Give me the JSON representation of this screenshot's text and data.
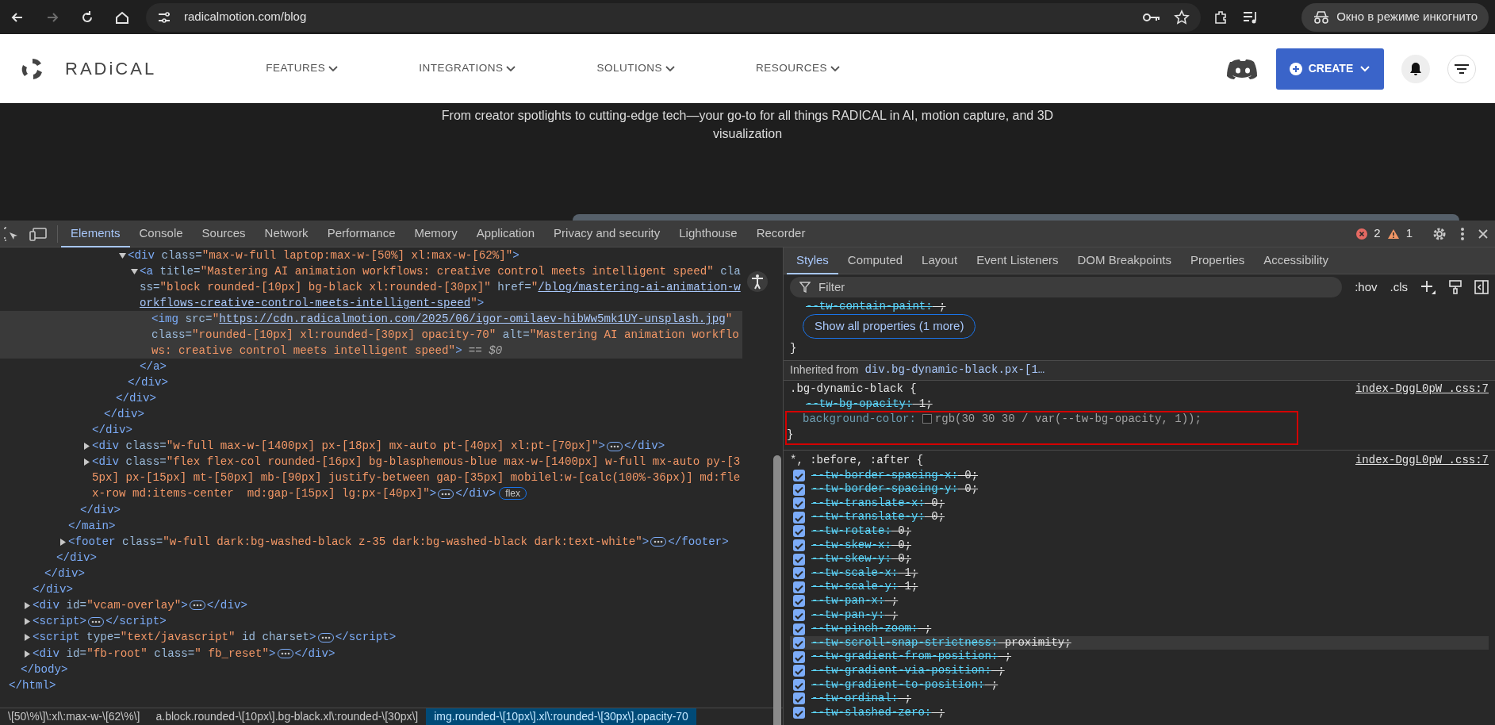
{
  "browser": {
    "nav_buttons": [
      {
        "kind": "back",
        "disabled": false
      },
      {
        "kind": "forward",
        "disabled": true
      },
      {
        "kind": "reload",
        "disabled": false
      },
      {
        "kind": "home",
        "disabled": false
      }
    ],
    "address": "radicalmotion.com/blog",
    "incognito_label": "Окно в режиме инкогнито"
  },
  "site": {
    "logo": "RADiCAL",
    "nav": [
      {
        "label": "FEATURES"
      },
      {
        "label": "INTEGRATIONS"
      },
      {
        "label": "SOLUTIONS"
      },
      {
        "label": "RESOURCES"
      }
    ],
    "create_button": "CREATE",
    "hero_text": "From creator spotlights to cutting-edge tech—your go-to for all things RADICAL in AI, motion capture, and 3D visualization"
  },
  "devtools": {
    "tabs": [
      {
        "label": "Elements",
        "selected": true
      },
      {
        "label": "Console",
        "selected": false
      },
      {
        "label": "Sources",
        "selected": false
      },
      {
        "label": "Network",
        "selected": false
      },
      {
        "label": "Performance",
        "selected": false
      },
      {
        "label": "Memory",
        "selected": false
      },
      {
        "label": "Application",
        "selected": false
      },
      {
        "label": "Privacy and security",
        "selected": false
      },
      {
        "label": "Lighthouse",
        "selected": false
      },
      {
        "label": "Recorder",
        "selected": false
      }
    ],
    "errors": "2",
    "warnings": "1",
    "dom": [
      {
        "selected": false,
        "close": [
          {
            "kind": "tag",
            "text": "</html>"
          }
        ],
        "children": [
          {
            "selected": false,
            "close": [
              {
                "kind": "tag",
                "text": "</body>"
              }
            ],
            "children": [
              {
                "selected": false,
                "close": [
                  {
                    "kind": "tag",
                    "text": "</div>"
                  }
                ],
                "children": [
                  {
                    "selected": false,
                    "close": [
                      {
                        "kind": "tag",
                        "text": "</div>"
                      }
                    ],
                    "children": [
                      {
                        "selected": false,
                        "close": [
                          {
                            "kind": "tag",
                            "text": "</div>"
                          }
                        ],
                        "children": [
                          {
                            "selected": false,
                            "close": [
                              {
                                "kind": "tag",
                                "text": "</main>"
                              }
                            ],
                            "children": [
                              {
                                "selected": false,
                                "close": [
                                  {
                                    "kind": "tag",
                                    "text": "</div>"
                                  }
                                ],
                                "children": [
                                  {
                                    "selected": false,
                                    "close": [
                                      {
                                        "kind": "tag",
                                        "text": "</div>"
                                      }
                                    ],
                                    "children": [
                                      {
                                        "selected": false,
                                        "close": [
                                          {
                                            "kind": "tag",
                                            "text": "</div>"
                                          }
                                        ],
                                        "children": [
                                          {
                                            "selected": false,
                                            "close": [
                                              {
                                                "kind": "tag",
                                                "text": "</div>"
                                              }
                                            ],
                                            "children": [
                                              {
                                                "selected": false,
                                                "expanded": true,
                                                "open": [
                                                  {
                                                    "kind": "tag",
                                                    "text": "<div"
                                                  },
                                                  {
                                                    "kind": "attr",
                                                    "text": " class="
                                                  },
                                                  {
                                                    "kind": "val",
                                                    "text": "\"max-w-full laptop:max-w-[50%] xl:max-w-[62%]\""
                                                  },
                                                  {
                                                    "kind": "tag",
                                                    "text": ">"
                                                  }
                                                ],
                                                "close": [
                                                  {
                                                    "kind": "tag",
                                                    "text": "</div>"
                                                  }
                                                ],
                                                "children": [
                                                  {
                                                    "selected": false,
                                                    "expanded": true,
                                                    "open": [
                                                      {
                                                        "kind": "tag",
                                                        "text": "<a"
                                                      },
                                                      {
                                                        "kind": "attr",
                                                        "text": " title="
                                                      },
                                                      {
                                                        "kind": "val",
                                                        "text": "\"Mastering AI animation workflows: creative control meets intelligent speed\""
                                                      },
                                                      {
                                                        "kind": "attr",
                                                        "text": " class="
                                                      },
                                                      {
                                                        "kind": "val",
                                                        "text": "\"block rounded-[10px] bg-black xl:rounded-[30px]\""
                                                      },
                                                      {
                                                        "kind": "attr",
                                                        "text": " href="
                                                      },
                                                      {
                                                        "kind": "val",
                                                        "text": "\""
                                                      },
                                                      {
                                                        "kind": "link",
                                                        "text": "/blog/mastering-ai-animation-workflows-creative-control-meets-intelligent-speed"
                                                      },
                                                      {
                                                        "kind": "val",
                                                        "text": "\""
                                                      },
                                                      {
                                                        "kind": "tag",
                                                        "text": ">"
                                                      }
                                                    ],
                                                    "close": [
                                                      {
                                                        "kind": "tag",
                                                        "text": "</a>"
                                                      }
                                                    ],
                                                    "children": [
                                                      {
                                                        "selected": true,
                                                        "marker": "== $0",
                                                        "open": [
                                                          {
                                                            "kind": "tag",
                                                            "text": "<img"
                                                          },
                                                          {
                                                            "kind": "attr",
                                                            "text": " src="
                                                          },
                                                          {
                                                            "kind": "val",
                                                            "text": "\""
                                                          },
                                                          {
                                                            "kind": "link",
                                                            "text": "https://cdn.radicalmotion.com/2025/06/igor-omilaev-hibWw5mk1UY-unsplash.jpg"
                                                          },
                                                          {
                                                            "kind": "val",
                                                            "text": "\""
                                                          },
                                                          {
                                                            "kind": "attr",
                                                            "text": " class="
                                                          },
                                                          {
                                                            "kind": "val",
                                                            "text": "\"rounded-[10px] xl:rounded-[30px] opacity-70\""
                                                          },
                                                          {
                                                            "kind": "attr",
                                                            "text": " alt="
                                                          },
                                                          {
                                                            "kind": "val",
                                                            "text": "\"Mastering AI animation workflows: creative control meets intelligent speed\""
                                                          },
                                                          {
                                                            "kind": "tag",
                                                            "text": ">"
                                                          }
                                                        ]
                                                      }
                                                    ]
                                                  }
                                                ]
                                              }
                                            ]
                                          }
                                        ]
                                      }
                                    ]
                                  },
                                  {
                                    "selected": false,
                                    "expanded": false,
                                    "open": [
                                      {
                                        "kind": "tag",
                                        "text": "<div"
                                      },
                                      {
                                        "kind": "attr",
                                        "text": " class="
                                      },
                                      {
                                        "kind": "val",
                                        "text": "\"w-full max-w-[1400px] px-[18px] mx-auto pt-[40px] xl:pt-[70px]\""
                                      },
                                      {
                                        "kind": "tag",
                                        "text": ">"
                                      }
                                    ],
                                    "close": [
                                      {
                                        "kind": "tag",
                                        "text": "</div>"
                                      }
                                    ]
                                  },
                                  {
                                    "selected": false,
                                    "expanded": false,
                                    "badge": "flex",
                                    "open": [
                                      {
                                        "kind": "tag",
                                        "text": "<div"
                                      },
                                      {
                                        "kind": "attr",
                                        "text": " class="
                                      },
                                      {
                                        "kind": "val",
                                        "text": "\"flex flex-col rounded-[16px] bg-blasphemous-blue max-w-[1400px] w-full mx-auto py-[35px] px-[15px] mt-[50px] mb-[90px] justify-between gap-[35px] mobilel:w-[calc(100%-36px)] md:flex-row md:items-center  md:gap-[15px] lg:px-[40px]\""
                                      },
                                      {
                                        "kind": "tag",
                                        "text": ">"
                                      }
                                    ],
                                    "close": [
                                      {
                                        "kind": "tag",
                                        "text": "</div>"
                                      }
                                    ]
                                  }
                                ]
                              }
                            ]
                          },
                          {
                            "selected": false,
                            "expanded": false,
                            "open": [
                              {
                                "kind": "tag",
                                "text": "<footer"
                              },
                              {
                                "kind": "attr",
                                "text": " class="
                              },
                              {
                                "kind": "val",
                                "text": "\"w-full dark:bg-washed-black z-35 dark:bg-washed-black dark:text-white\""
                              },
                              {
                                "kind": "tag",
                                "text": ">"
                              }
                            ],
                            "close": [
                              {
                                "kind": "tag",
                                "text": "</footer>"
                              }
                            ]
                          }
                        ]
                      }
                    ]
                  }
                ]
              },
              {
                "selected": false,
                "expanded": false,
                "open": [
                  {
                    "kind": "tag",
                    "text": "<div"
                  },
                  {
                    "kind": "attr",
                    "text": " id="
                  },
                  {
                    "kind": "val",
                    "text": "\"vcam-overlay\""
                  },
                  {
                    "kind": "tag",
                    "text": ">"
                  }
                ],
                "close": [
                  {
                    "kind": "tag",
                    "text": "</div>"
                  }
                ]
              },
              {
                "selected": false,
                "expanded": false,
                "open": [
                  {
                    "kind": "tag",
                    "text": "<script>"
                  }
                ],
                "close": [
                  {
                    "kind": "tag",
                    "text": "</script>"
                  }
                ]
              },
              {
                "selected": false,
                "expanded": false,
                "open": [
                  {
                    "kind": "tag",
                    "text": "<script"
                  },
                  {
                    "kind": "attr",
                    "text": " type="
                  },
                  {
                    "kind": "val",
                    "text": "\"text/javascript\""
                  },
                  {
                    "kind": "attr",
                    "text": " id charset"
                  },
                  {
                    "kind": "tag",
                    "text": ">"
                  }
                ],
                "close": [
                  {
                    "kind": "tag",
                    "text": "</script>"
                  }
                ]
              },
              {
                "selected": false,
                "expanded": false,
                "open": [
                  {
                    "kind": "tag",
                    "text": "<div"
                  },
                  {
                    "kind": "attr",
                    "text": " id="
                  },
                  {
                    "kind": "val",
                    "text": "\"fb-root\""
                  },
                  {
                    "kind": "attr",
                    "text": " class="
                  },
                  {
                    "kind": "val",
                    "text": "\" fb_reset\""
                  },
                  {
                    "kind": "tag",
                    "text": ">"
                  }
                ],
                "close": [
                  {
                    "kind": "tag",
                    "text": "</div>"
                  }
                ]
              }
            ]
          }
        ]
      }
    ],
    "breadcrumbs": [
      {
        "label": "\\[50\\%\\]\\:xl\\:max-w-\\[62\\%\\]",
        "selected": false
      },
      {
        "label": "a.block.rounded-\\[10px\\].bg-black.xl\\:rounded-\\[30px\\]",
        "selected": false
      },
      {
        "label": "img.rounded-\\[10px\\].xl\\:rounded-\\[30px\\].opacity-70",
        "selected": true
      }
    ],
    "styles": {
      "tabs": [
        {
          "label": "Styles",
          "selected": true
        },
        {
          "label": "Computed",
          "selected": false
        },
        {
          "label": "Layout",
          "selected": false
        },
        {
          "label": "Event Listeners",
          "selected": false
        },
        {
          "label": "DOM Breakpoints",
          "selected": false
        },
        {
          "label": "Properties",
          "selected": false
        },
        {
          "label": "Accessibility",
          "selected": false
        }
      ],
      "filter_placeholder": "Filter",
      "hov": ":hov",
      "cls": ".cls",
      "tail_prop": {
        "name": "--tw-contain-paint:",
        "value": " ;",
        "overridden": true
      },
      "show_all": "Show all properties (1 more)",
      "tail_close": "}",
      "inherited_label": "Inherited from",
      "inherited_link": "div.bg-dynamic-black.px-[1…",
      "rules": [
        {
          "selector": ".bg-dynamic-black {",
          "source": "index-DggL0pW_.css:7",
          "close": "}",
          "props": [
            {
              "name": "--tw-bg-opacity:",
              "value": " 1;",
              "overridden": true,
              "annotated": false
            },
            {
              "name": "background-color:",
              "color": "#1e1e1e",
              "value": "rgb(30 30 30 / var(--tw-bg-opacity, 1));",
              "overridden": false,
              "annotated": true
            }
          ]
        },
        {
          "selector": "*, :before, :after {",
          "source": "index-DggL0pW_.css:7",
          "props": [
            {
              "name": "--tw-border-spacing-x:",
              "value": " 0;",
              "checked": true,
              "overridden": true,
              "hovered": false
            },
            {
              "name": "--tw-border-spacing-y:",
              "value": " 0;",
              "checked": true,
              "overridden": true,
              "hovered": false
            },
            {
              "name": "--tw-translate-x:",
              "value": " 0;",
              "checked": true,
              "overridden": true,
              "hovered": false
            },
            {
              "name": "--tw-translate-y:",
              "value": " 0;",
              "checked": true,
              "overridden": true,
              "hovered": false
            },
            {
              "name": "--tw-rotate:",
              "value": " 0;",
              "checked": true,
              "overridden": true,
              "hovered": false
            },
            {
              "name": "--tw-skew-x:",
              "value": " 0;",
              "checked": true,
              "overridden": true,
              "hovered": false
            },
            {
              "name": "--tw-skew-y:",
              "value": " 0;",
              "checked": true,
              "overridden": true,
              "hovered": false
            },
            {
              "name": "--tw-scale-x:",
              "value": " 1;",
              "checked": true,
              "overridden": true,
              "hovered": false
            },
            {
              "name": "--tw-scale-y:",
              "value": " 1;",
              "checked": true,
              "overridden": true,
              "hovered": false
            },
            {
              "name": "--tw-pan-x:",
              "value": " ;",
              "checked": true,
              "overridden": true,
              "hovered": false
            },
            {
              "name": "--tw-pan-y:",
              "value": " ;",
              "checked": true,
              "overridden": true,
              "hovered": false
            },
            {
              "name": "--tw-pinch-zoom:",
              "value": " ;",
              "checked": true,
              "overridden": true,
              "hovered": false
            },
            {
              "name": "--tw-scroll-snap-strictness:",
              "value": " proximity;",
              "checked": true,
              "overridden": true,
              "hovered": true
            },
            {
              "name": "--tw-gradient-from-position:",
              "value": " ;",
              "checked": true,
              "overridden": true,
              "hovered": false
            },
            {
              "name": "--tw-gradient-via-position:",
              "value": " ;",
              "checked": true,
              "overridden": true,
              "hovered": false
            },
            {
              "name": "--tw-gradient-to-position:",
              "value": " ;",
              "checked": true,
              "overridden": true,
              "hovered": false
            },
            {
              "name": "--tw-ordinal:",
              "value": " ;",
              "checked": true,
              "overridden": true,
              "hovered": false
            },
            {
              "name": "--tw-slashed-zero:",
              "value": " ;",
              "checked": true,
              "overridden": true,
              "hovered": false
            }
          ]
        }
      ]
    }
  }
}
